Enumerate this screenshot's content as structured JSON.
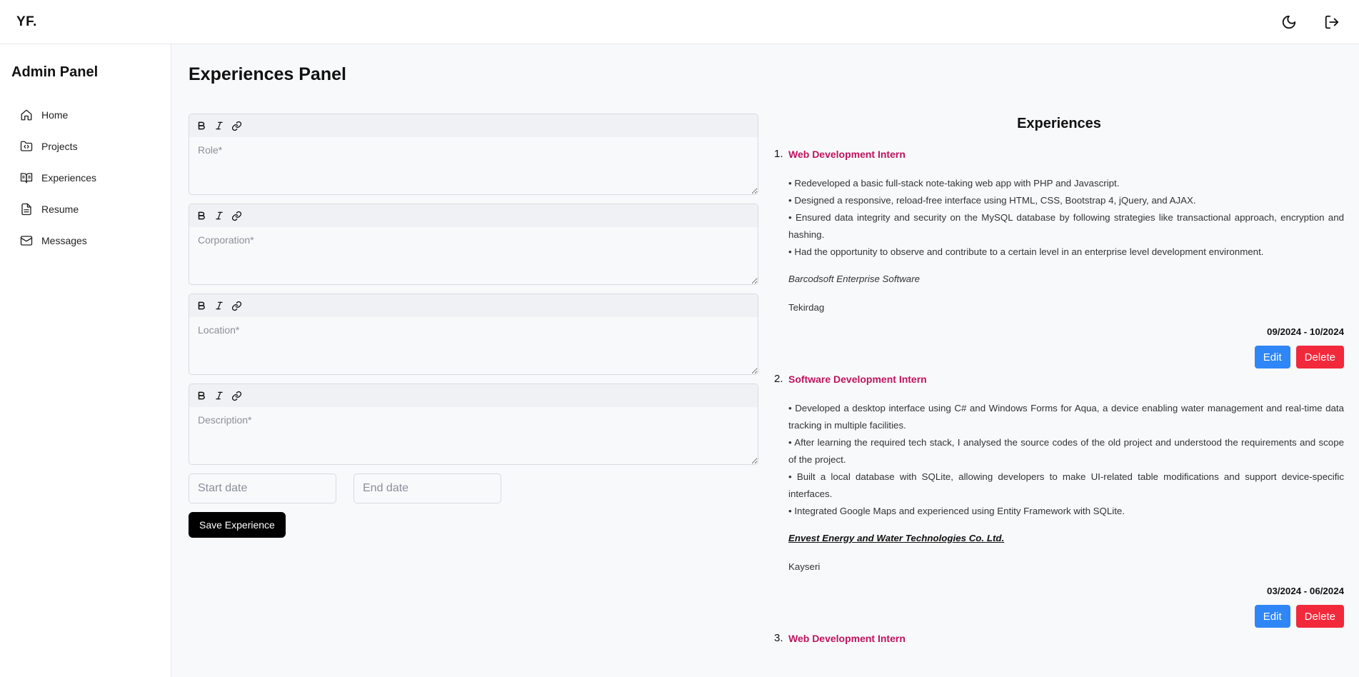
{
  "header": {
    "logo": "YF."
  },
  "sidebar": {
    "title": "Admin Panel",
    "items": [
      {
        "label": "Home",
        "icon": "home-icon"
      },
      {
        "label": "Projects",
        "icon": "folder-code-icon"
      },
      {
        "label": "Experiences",
        "icon": "book-open-icon"
      },
      {
        "label": "Resume",
        "icon": "file-text-icon"
      },
      {
        "label": "Messages",
        "icon": "mail-icon"
      }
    ]
  },
  "main": {
    "title": "Experiences Panel"
  },
  "form": {
    "role_placeholder": "Role*",
    "corporation_placeholder": "Corporation*",
    "location_placeholder": "Location*",
    "description_placeholder": "Description*",
    "start_placeholder": "Start date",
    "end_placeholder": "End date",
    "save_label": "Save Experience"
  },
  "experiences": {
    "title": "Experiences",
    "edit_label": "Edit",
    "delete_label": "Delete",
    "items": [
      {
        "num": "1.",
        "role": "Web Development Intern",
        "bullets": [
          "• Redeveloped a basic full-stack note-taking web app with PHP and Javascript.",
          "• Designed a responsive, reload-free interface using HTML, CSS, Bootstrap 4, jQuery, and AJAX.",
          "• Ensured data integrity and security on the MySQL database by following strategies like transactional approach, encryption and hashing.",
          "• Had the opportunity to observe and contribute to a certain level in an enterprise level development environment."
        ],
        "corporation": "Barcodsoft Enterprise Software",
        "location": "Tekirdag",
        "dates": "09/2024 - 10/2024"
      },
      {
        "num": "2.",
        "role": "Software Development Intern",
        "bullets": [
          "• Developed a desktop interface using C# and Windows Forms for Aqua, a device enabling water management and real-time data tracking in multiple facilities.",
          "• After learning the required tech stack, I analysed the source codes of the old project and understood the requirements and scope of the project.",
          "• Built a local database with SQLite, allowing developers to make UI-related table modifications and support device-specific interfaces.",
          "• Integrated Google Maps and experienced using Entity Framework with SQLite."
        ],
        "corporation": "Envest Energy and Water Technologies Co. Ltd.",
        "location": "Kayseri",
        "dates": "03/2024 - 06/2024"
      },
      {
        "num": "3.",
        "role": "Web Development Intern"
      }
    ]
  }
}
